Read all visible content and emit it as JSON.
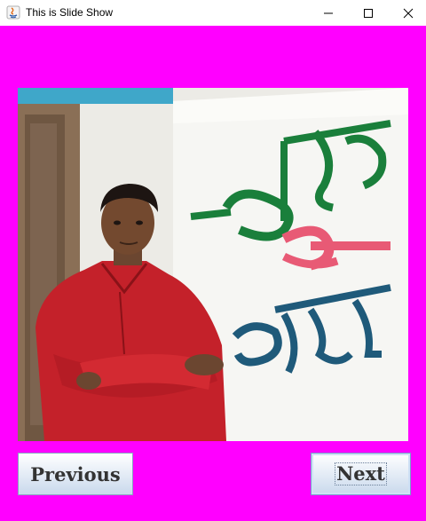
{
  "window": {
    "title": "This is Slide Show",
    "minimize_icon": "minimize-icon",
    "maximize_icon": "maximize-icon",
    "close_icon": "close-icon"
  },
  "slideshow": {
    "background_color": "#ff00ff",
    "current_slide": {
      "image_kind": "photo of man in red kurta standing beside wall painting",
      "wall_text_lines": [
        "এসো",
        "হে",
        "বৈশাখ"
      ],
      "wall_text_colors": [
        "#1a7f3b",
        "#e85a75",
        "#1f5a7a"
      ]
    }
  },
  "controls": {
    "previous_label": "Previous",
    "next_label": "Next"
  }
}
